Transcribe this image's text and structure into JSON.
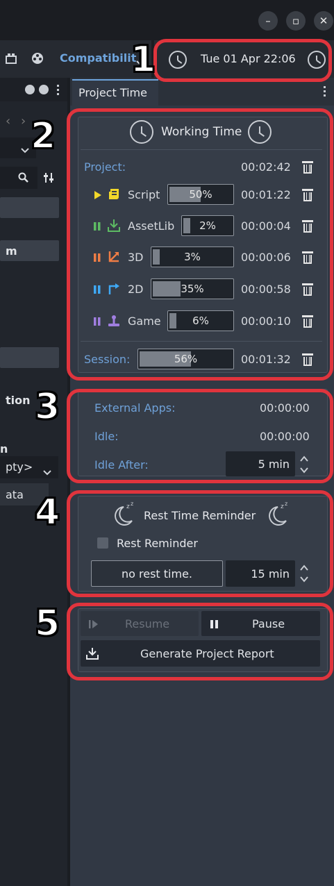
{
  "window": {
    "minimize_glyph": "–",
    "maximize_glyph": "▫",
    "close_glyph": "✕"
  },
  "topbar": {
    "renderer_label": "Compatibilit",
    "datetime": "Tue 01 Apr 22:06"
  },
  "left_panel": {
    "partial_texts": [
      "m",
      "tion",
      "n",
      "pty>",
      "ata"
    ]
  },
  "tab": {
    "label": "Project Time"
  },
  "working_time": {
    "title": "Working Time",
    "project_label": "Project:",
    "project_time": "00:02:42",
    "rows": [
      {
        "name": "Script",
        "percent_label": "50%",
        "percent": 50,
        "time": "00:01:22",
        "color": "#f2d82a",
        "state": "playing"
      },
      {
        "name": "AssetLib",
        "percent_label": "2%",
        "percent": 2,
        "time": "00:00:04",
        "color": "#5dbb63",
        "state": "paused"
      },
      {
        "name": "3D",
        "percent_label": "3%",
        "percent": 3,
        "time": "00:00:06",
        "color": "#ef7d45",
        "state": "paused"
      },
      {
        "name": "2D",
        "percent_label": "35%",
        "percent": 35,
        "time": "00:00:58",
        "color": "#3fa9f5",
        "state": "paused"
      },
      {
        "name": "Game",
        "percent_label": "6%",
        "percent": 6,
        "time": "00:00:10",
        "color": "#a07ee0",
        "state": "paused"
      }
    ],
    "session_label": "Session:",
    "session_percent_label": "56%",
    "session_percent": 56,
    "session_time": "00:01:32"
  },
  "external": {
    "external_apps_label": "External Apps:",
    "external_apps_time": "00:00:00",
    "idle_label": "Idle:",
    "idle_time": "00:00:00",
    "idle_after_label": "Idle After:",
    "idle_after_value": "5 min"
  },
  "rest": {
    "title": "Rest Time Reminder",
    "checkbox_label": "Rest Reminder",
    "status_text": "no rest time.",
    "interval_value": "15 min"
  },
  "controls": {
    "resume_label": "Resume",
    "pause_label": "Pause",
    "report_label": "Generate Project Report"
  },
  "annotations": [
    "1",
    "2",
    "3",
    "4",
    "5"
  ]
}
